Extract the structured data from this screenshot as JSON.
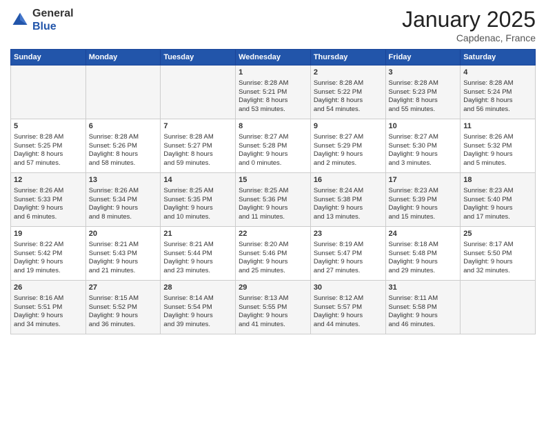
{
  "header": {
    "logo_general": "General",
    "logo_blue": "Blue",
    "month_title": "January 2025",
    "location": "Capdenac, France"
  },
  "weekdays": [
    "Sunday",
    "Monday",
    "Tuesday",
    "Wednesday",
    "Thursday",
    "Friday",
    "Saturday"
  ],
  "weeks": [
    [
      {
        "day": "",
        "info": ""
      },
      {
        "day": "",
        "info": ""
      },
      {
        "day": "",
        "info": ""
      },
      {
        "day": "1",
        "info": "Sunrise: 8:28 AM\nSunset: 5:21 PM\nDaylight: 8 hours\nand 53 minutes."
      },
      {
        "day": "2",
        "info": "Sunrise: 8:28 AM\nSunset: 5:22 PM\nDaylight: 8 hours\nand 54 minutes."
      },
      {
        "day": "3",
        "info": "Sunrise: 8:28 AM\nSunset: 5:23 PM\nDaylight: 8 hours\nand 55 minutes."
      },
      {
        "day": "4",
        "info": "Sunrise: 8:28 AM\nSunset: 5:24 PM\nDaylight: 8 hours\nand 56 minutes."
      }
    ],
    [
      {
        "day": "5",
        "info": "Sunrise: 8:28 AM\nSunset: 5:25 PM\nDaylight: 8 hours\nand 57 minutes."
      },
      {
        "day": "6",
        "info": "Sunrise: 8:28 AM\nSunset: 5:26 PM\nDaylight: 8 hours\nand 58 minutes."
      },
      {
        "day": "7",
        "info": "Sunrise: 8:28 AM\nSunset: 5:27 PM\nDaylight: 8 hours\nand 59 minutes."
      },
      {
        "day": "8",
        "info": "Sunrise: 8:27 AM\nSunset: 5:28 PM\nDaylight: 9 hours\nand 0 minutes."
      },
      {
        "day": "9",
        "info": "Sunrise: 8:27 AM\nSunset: 5:29 PM\nDaylight: 9 hours\nand 2 minutes."
      },
      {
        "day": "10",
        "info": "Sunrise: 8:27 AM\nSunset: 5:30 PM\nDaylight: 9 hours\nand 3 minutes."
      },
      {
        "day": "11",
        "info": "Sunrise: 8:26 AM\nSunset: 5:32 PM\nDaylight: 9 hours\nand 5 minutes."
      }
    ],
    [
      {
        "day": "12",
        "info": "Sunrise: 8:26 AM\nSunset: 5:33 PM\nDaylight: 9 hours\nand 6 minutes."
      },
      {
        "day": "13",
        "info": "Sunrise: 8:26 AM\nSunset: 5:34 PM\nDaylight: 9 hours\nand 8 minutes."
      },
      {
        "day": "14",
        "info": "Sunrise: 8:25 AM\nSunset: 5:35 PM\nDaylight: 9 hours\nand 10 minutes."
      },
      {
        "day": "15",
        "info": "Sunrise: 8:25 AM\nSunset: 5:36 PM\nDaylight: 9 hours\nand 11 minutes."
      },
      {
        "day": "16",
        "info": "Sunrise: 8:24 AM\nSunset: 5:38 PM\nDaylight: 9 hours\nand 13 minutes."
      },
      {
        "day": "17",
        "info": "Sunrise: 8:23 AM\nSunset: 5:39 PM\nDaylight: 9 hours\nand 15 minutes."
      },
      {
        "day": "18",
        "info": "Sunrise: 8:23 AM\nSunset: 5:40 PM\nDaylight: 9 hours\nand 17 minutes."
      }
    ],
    [
      {
        "day": "19",
        "info": "Sunrise: 8:22 AM\nSunset: 5:42 PM\nDaylight: 9 hours\nand 19 minutes."
      },
      {
        "day": "20",
        "info": "Sunrise: 8:21 AM\nSunset: 5:43 PM\nDaylight: 9 hours\nand 21 minutes."
      },
      {
        "day": "21",
        "info": "Sunrise: 8:21 AM\nSunset: 5:44 PM\nDaylight: 9 hours\nand 23 minutes."
      },
      {
        "day": "22",
        "info": "Sunrise: 8:20 AM\nSunset: 5:46 PM\nDaylight: 9 hours\nand 25 minutes."
      },
      {
        "day": "23",
        "info": "Sunrise: 8:19 AM\nSunset: 5:47 PM\nDaylight: 9 hours\nand 27 minutes."
      },
      {
        "day": "24",
        "info": "Sunrise: 8:18 AM\nSunset: 5:48 PM\nDaylight: 9 hours\nand 29 minutes."
      },
      {
        "day": "25",
        "info": "Sunrise: 8:17 AM\nSunset: 5:50 PM\nDaylight: 9 hours\nand 32 minutes."
      }
    ],
    [
      {
        "day": "26",
        "info": "Sunrise: 8:16 AM\nSunset: 5:51 PM\nDaylight: 9 hours\nand 34 minutes."
      },
      {
        "day": "27",
        "info": "Sunrise: 8:15 AM\nSunset: 5:52 PM\nDaylight: 9 hours\nand 36 minutes."
      },
      {
        "day": "28",
        "info": "Sunrise: 8:14 AM\nSunset: 5:54 PM\nDaylight: 9 hours\nand 39 minutes."
      },
      {
        "day": "29",
        "info": "Sunrise: 8:13 AM\nSunset: 5:55 PM\nDaylight: 9 hours\nand 41 minutes."
      },
      {
        "day": "30",
        "info": "Sunrise: 8:12 AM\nSunset: 5:57 PM\nDaylight: 9 hours\nand 44 minutes."
      },
      {
        "day": "31",
        "info": "Sunrise: 8:11 AM\nSunset: 5:58 PM\nDaylight: 9 hours\nand 46 minutes."
      },
      {
        "day": "",
        "info": ""
      }
    ]
  ]
}
